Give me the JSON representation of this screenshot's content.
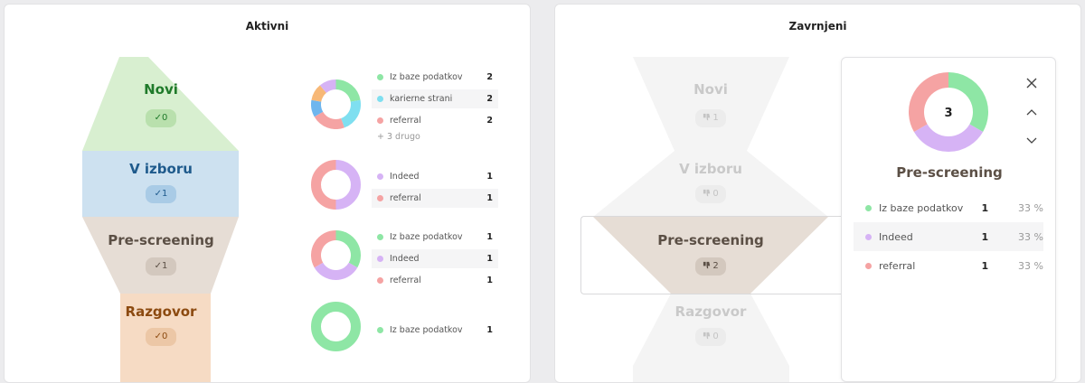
{
  "colors": {
    "green": "#8ee6a5",
    "cyan": "#7fdff0",
    "purple": "#d6b3f5",
    "salmon": "#f5a3a3",
    "orange": "#f7b877",
    "blue": "#6fb6ee",
    "novi_fill": "#d8efd0",
    "v_izboru_fill": "#cde1f0",
    "prescreen_fill": "#e6ddd5",
    "razgovor_fill": "#f6dbc4",
    "faded_fill": "#f2f2f2"
  },
  "left": {
    "title": "Aktivni",
    "stages": [
      {
        "label": "Novi",
        "badge": "✓0",
        "color": "#1f7a2a",
        "badge_bg": "#b9e0ad",
        "badge_color": "#1f7a2a"
      },
      {
        "label": "V izboru",
        "badge": "✓1",
        "color": "#1e5a8c",
        "badge_bg": "#a9cbe6",
        "badge_color": "#1e5a8c"
      },
      {
        "label": "Pre-screening",
        "badge": "✓1",
        "color": "#5b4f45",
        "badge_bg": "#d3c8be",
        "badge_color": "#5b4f45"
      },
      {
        "label": "Razgovor",
        "badge": "✓0",
        "color": "#8c4a10",
        "badge_bg": "#ecc7a6",
        "badge_color": "#8c4a10"
      }
    ],
    "source_groups": [
      {
        "donut": [
          {
            "v": 2,
            "c": "#8ee6a5"
          },
          {
            "v": 2,
            "c": "#7fdff0"
          },
          {
            "v": 2,
            "c": "#f5a3a3"
          },
          {
            "v": 1,
            "c": "#6fb6ee"
          },
          {
            "v": 1,
            "c": "#f7b877"
          },
          {
            "v": 1,
            "c": "#d6b3f5"
          }
        ],
        "rows": [
          {
            "name": "Iz baze podatkov",
            "count": "2",
            "color": "#8ee6a5"
          },
          {
            "name": "karierne strani",
            "count": "2",
            "color": "#7fdff0"
          },
          {
            "name": "referral",
            "count": "2",
            "color": "#f5a3a3"
          }
        ],
        "more": "+ 3 drugo"
      },
      {
        "donut": [
          {
            "v": 1,
            "c": "#d6b3f5"
          },
          {
            "v": 1,
            "c": "#f5a3a3"
          }
        ],
        "rows": [
          {
            "name": "Indeed",
            "count": "1",
            "color": "#d6b3f5"
          },
          {
            "name": "referral",
            "count": "1",
            "color": "#f5a3a3"
          }
        ]
      },
      {
        "donut": [
          {
            "v": 1,
            "c": "#8ee6a5"
          },
          {
            "v": 1,
            "c": "#d6b3f5"
          },
          {
            "v": 1,
            "c": "#f5a3a3"
          }
        ],
        "rows": [
          {
            "name": "Iz baze podatkov",
            "count": "1",
            "color": "#8ee6a5"
          },
          {
            "name": "Indeed",
            "count": "1",
            "color": "#d6b3f5"
          },
          {
            "name": "referral",
            "count": "1",
            "color": "#f5a3a3"
          }
        ]
      },
      {
        "donut": [
          {
            "v": 1,
            "c": "#8ee6a5"
          }
        ],
        "rows": [
          {
            "name": "Iz baze podatkov",
            "count": "1",
            "color": "#8ee6a5"
          }
        ]
      }
    ]
  },
  "right": {
    "title": "Zavrnjeni",
    "stages": [
      {
        "label": "Novi",
        "badge": "1"
      },
      {
        "label": "V izboru",
        "badge": "0"
      },
      {
        "label": "Pre-screening",
        "badge": "2"
      },
      {
        "label": "Razgovor",
        "badge": "0"
      }
    ],
    "detail": {
      "total": "3",
      "title": "Pre-screening",
      "donut": [
        {
          "v": 1,
          "c": "#8ee6a5"
        },
        {
          "v": 1,
          "c": "#d6b3f5"
        },
        {
          "v": 1,
          "c": "#f5a3a3"
        }
      ],
      "rows": [
        {
          "name": "Iz baze podatkov",
          "count": "1",
          "pct": "33 %",
          "color": "#8ee6a5"
        },
        {
          "name": "Indeed",
          "count": "1",
          "pct": "33 %",
          "color": "#d6b3f5"
        },
        {
          "name": "referral",
          "count": "1",
          "pct": "33 %",
          "color": "#f5a3a3"
        }
      ]
    }
  }
}
